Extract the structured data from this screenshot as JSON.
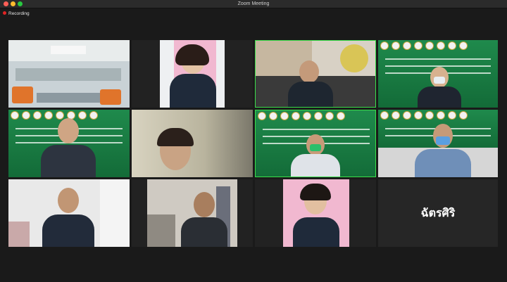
{
  "window": {
    "title": "Zoom Meeting"
  },
  "recording": {
    "label": "Recording"
  },
  "participants": [
    {
      "tile": 1,
      "type": "video"
    },
    {
      "tile": 2,
      "type": "video"
    },
    {
      "tile": 3,
      "type": "video",
      "active_speaker": true
    },
    {
      "tile": 4,
      "type": "video"
    },
    {
      "tile": 5,
      "type": "video"
    },
    {
      "tile": 6,
      "type": "video"
    },
    {
      "tile": 7,
      "type": "video"
    },
    {
      "tile": 8,
      "type": "video"
    },
    {
      "tile": 9,
      "type": "video"
    },
    {
      "tile": 10,
      "type": "video"
    },
    {
      "tile": 11,
      "type": "video"
    },
    {
      "tile": 12,
      "type": "name",
      "name": "ฉัตรศิริ"
    }
  ],
  "colors": {
    "active_border": "#3adf4a",
    "banner_green": "#1f8a4c",
    "recording_dot": "#e02424"
  }
}
